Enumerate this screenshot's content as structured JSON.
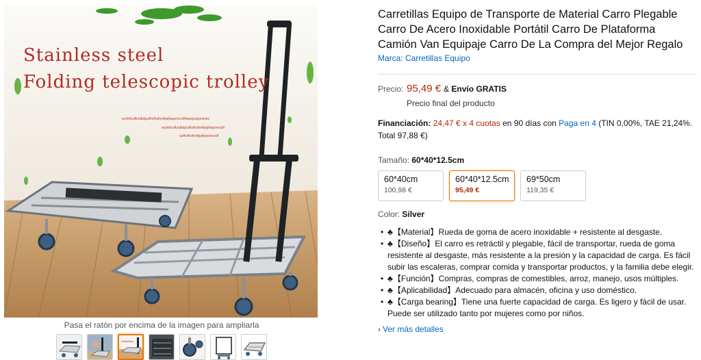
{
  "product": {
    "title": "Carretillas Equipo de Transporte de Material Carro Plegable Carro De Acero Inoxidable Portátil Carro De Plataforma Camión Van Equipaje Carro De La Compra del Mejor Regalo",
    "brand": "Marca: Carretillas Equipo"
  },
  "image": {
    "overlay_line1": "Stainless steel",
    "overlay_line2": "Folding telescopic trolley",
    "tiny_line1": "wryhfioufksdbdjsufhsfhsferiitjwjfaeprevcdfhawquopprieckx",
    "tiny_line2": "wryhfioufksdbdjsufhsfhsferiitjwjfaeprevcdf",
    "tiny_line3": "sufhsfhsferiitjwjfaeprevcdf",
    "hover_hint": "Pasa el ratón por encima de la imagen para ampliarla",
    "thumbnails": [
      "thumb-1",
      "thumb-2",
      "thumb-3",
      "thumb-4",
      "thumb-5",
      "thumb-6",
      "thumb-7"
    ],
    "active_thumbnail": 3
  },
  "price": {
    "label": "Precio:",
    "value": "95,49 €",
    "shipping_prefix": "& ",
    "shipping": "Envío GRATIS",
    "final_note": "Precio final del producto"
  },
  "financing": {
    "label": "Financiación:",
    "installments": "24,47 € x 4 cuotas",
    "middle": " en 90 días con ",
    "link": "Paga en 4",
    "tail": " (TIN 0,00%, TAE 21,24%. Total 97,88 €)"
  },
  "size": {
    "label": "Tamaño:",
    "selected": "60*40*12.5cm",
    "options": [
      {
        "name": "60*40cm",
        "price": "100,98 €"
      },
      {
        "name": "60*40*12.5cm",
        "price": "95,49 €"
      },
      {
        "name": "69*50cm",
        "price": "119,35 €"
      }
    ]
  },
  "color": {
    "label": "Color:",
    "value": "Silver"
  },
  "bullets": [
    "♣【Material】Rueda de goma de acero inoxidable + resistente al desgaste.",
    "♣【Diseño】El carro es retráctil y plegable, fácil de transportar, rueda de goma resistente al desgaste, más resistente a la presión y la capacidad de carga. Es fácil subir las escaleras, comprar comida y transportar productos, y la familia debe elegir.",
    "♣【Función】Compras, compras de comestibles, arroz, manejo, usos múltiples.",
    "♣【Aplicabilidad】Adecuado para almacén, oficina y uso doméstico.",
    "♣【Carga bearing】Tiene una fuerte capacidad de carga. Es ligero y fácil de usar. Puede ser utilizado tanto por mujeres como por niños."
  ],
  "more_details": "Ver más detalles",
  "colors": {
    "accent": "#e77600",
    "price_red": "#b12704",
    "link_blue": "#0066c0",
    "overlay_red": "#b42a22"
  }
}
